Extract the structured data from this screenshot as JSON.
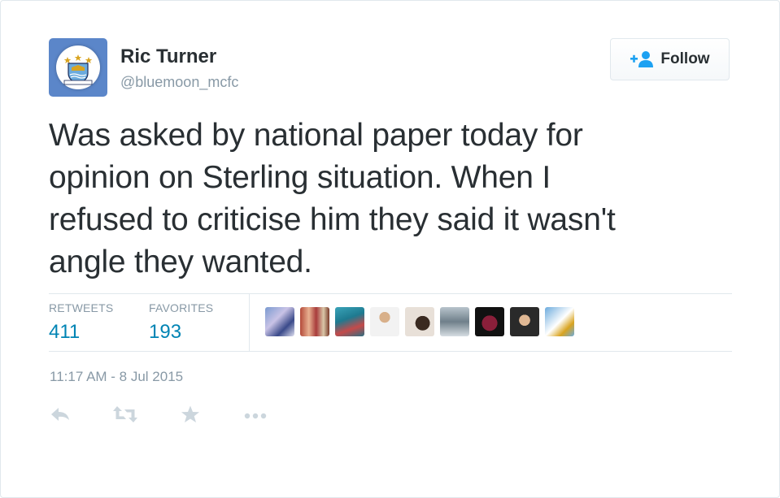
{
  "user": {
    "name": "Ric Turner",
    "handle": "@bluemoon_mcfc"
  },
  "follow_button": {
    "label": "Follow",
    "icon": "follow-person-plus-icon"
  },
  "tweet": {
    "lines": [
      "Was asked by national paper today for",
      "opinion on Sterling situation. When I",
      "refused to criticise him they said it wasn't",
      "angle they wanted."
    ]
  },
  "stats": {
    "retweets_label": "RETWEETS",
    "retweets_value": "411",
    "favorites_label": "FAVORITES",
    "favorites_value": "193"
  },
  "timestamp": "11:17 AM - 8 Jul 2015",
  "actions": [
    {
      "icon": "reply-icon"
    },
    {
      "icon": "retweet-icon"
    },
    {
      "icon": "favorite-star-icon"
    },
    {
      "icon": "more-icon"
    }
  ],
  "colors": {
    "link_blue": "#0084b4",
    "muted_gray": "#8899a6",
    "text_dark": "#292f33",
    "border": "#e1e8ed",
    "action_gray": "#ccd6dd"
  }
}
